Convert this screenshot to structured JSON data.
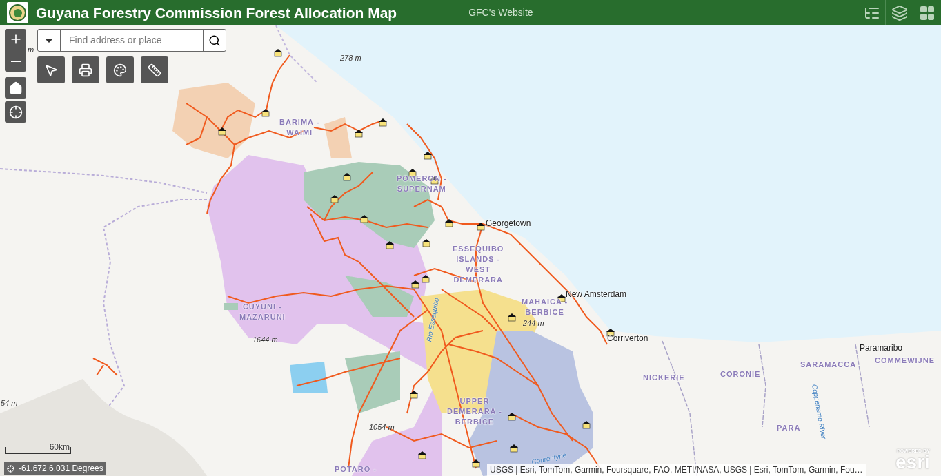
{
  "header": {
    "title": "Guyana Forestry Commission Forest Allocation Map",
    "link": "GFC's Website"
  },
  "search": {
    "placeholder": "Find address or place"
  },
  "map_labels": [
    {
      "kind": "elevation",
      "lines": [
        "m"
      ]
    },
    {
      "kind": "elevation",
      "lines": [
        "278 m"
      ]
    },
    {
      "kind": "region",
      "lines": [
        "BARIMA -",
        "WAIMI"
      ]
    },
    {
      "kind": "region",
      "lines": [
        "POMERON -",
        "SUPERNAM"
      ]
    },
    {
      "kind": "city",
      "lines": [
        "Georgetown"
      ]
    },
    {
      "kind": "region",
      "lines": [
        "ESSEQUIBO",
        "ISLANDS -",
        "WEST",
        "DEMERARA"
      ]
    },
    {
      "kind": "city",
      "lines": [
        "New Amsterdam"
      ]
    },
    {
      "kind": "region",
      "lines": [
        "MAHAICA -",
        "BERBICE"
      ]
    },
    {
      "kind": "region",
      "lines": [
        "CUYUNI -",
        "MAZARUNI"
      ]
    },
    {
      "kind": "elevation",
      "lines": [
        "244 m"
      ]
    },
    {
      "kind": "city",
      "lines": [
        "Corriverton"
      ]
    },
    {
      "kind": "elevation",
      "lines": [
        "1644 m"
      ]
    },
    {
      "kind": "city",
      "lines": [
        "Paramaribo"
      ]
    },
    {
      "kind": "region",
      "lines": [
        "SARAMACCA"
      ]
    },
    {
      "kind": "region",
      "lines": [
        "COMMEWIJNE"
      ]
    },
    {
      "kind": "region",
      "lines": [
        "NICKERIE"
      ]
    },
    {
      "kind": "region",
      "lines": [
        "CORONIE"
      ]
    },
    {
      "kind": "river",
      "lines": [
        "Rio Essequibo"
      ]
    },
    {
      "kind": "region",
      "lines": [
        "UPPER",
        "DEMERARA -",
        "BERBICE"
      ]
    },
    {
      "kind": "region",
      "lines": [
        "PARA"
      ]
    },
    {
      "kind": "elevation",
      "lines": [
        "1054 m"
      ]
    },
    {
      "kind": "elevation",
      "lines": [
        "54 m"
      ]
    },
    {
      "kind": "river",
      "lines": [
        "Coppename River"
      ]
    },
    {
      "kind": "river",
      "lines": [
        "Courentyne"
      ]
    },
    {
      "kind": "region",
      "lines": [
        "POTARO -"
      ]
    }
  ],
  "scale": "60km",
  "coordinates": "-61.672 6.031 Degrees",
  "attribution": "USGS | Esri, TomTom, Garmin, Foursquare, FAO, METI/NASA, USGS | Esri, TomTom, Garmin, Fou…",
  "esri": {
    "powered": "POWERED BY",
    "logo": "esri"
  }
}
